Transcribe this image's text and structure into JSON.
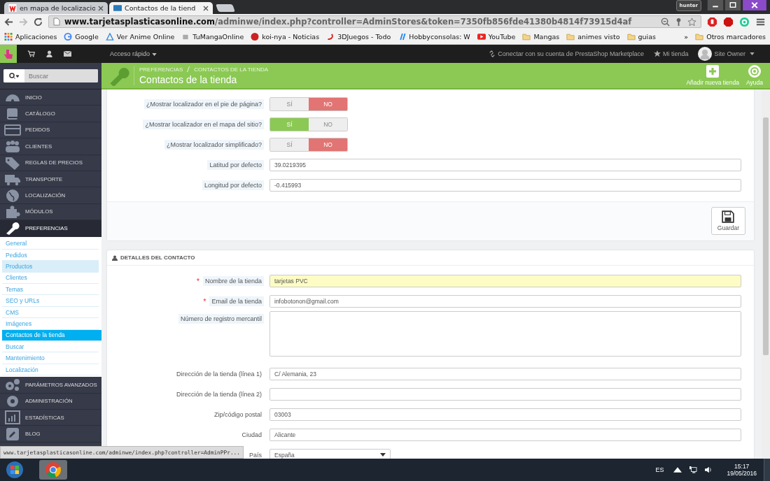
{
  "browser": {
    "tabs": [
      {
        "title": "en mapa de localizacio",
        "selected": false
      },
      {
        "title": "Contactos de la tiend",
        "selected": true
      }
    ],
    "user_badge": "hunter",
    "address": {
      "domain": "www.tarjetasplasticasonline.com",
      "path": "/adminwe/index.php?controller=AdminStores&token=7350fb856fde41380b4814f73915d4af"
    },
    "bookmarks": [
      "Aplicaciones",
      "Google",
      "Ver Anime Online",
      "TuMangaOnline",
      "koi-nya - Noticias",
      "3DJuegos - Todo",
      "Hobbyconsolas: W",
      "YouTube",
      "Mangas",
      "animes visto",
      "guias"
    ],
    "bookmarks_more": "»",
    "other_bookmarks": "Otros marcadores"
  },
  "topnav": {
    "quick_access": "Acceso rápido",
    "marketplace": "Conectar con su cuenta de PrestaShop Marketplace",
    "my_store": "Mi tienda",
    "user": "Site Owner"
  },
  "sidebar": {
    "search_placeholder": "Buscar",
    "items": [
      {
        "label": "INICIO",
        "expanded": false
      },
      {
        "label": "CATÁLOGO",
        "expanded": false
      },
      {
        "label": "PEDIDOS",
        "expanded": false
      },
      {
        "label": "CLIENTES",
        "expanded": false
      },
      {
        "label": "REGLAS DE PRECIOS",
        "expanded": false
      },
      {
        "label": "TRANSPORTE",
        "expanded": false
      },
      {
        "label": "LOCALIZACIÓN",
        "expanded": false
      },
      {
        "label": "MÓDULOS",
        "expanded": false
      },
      {
        "label": "PREFERENCIAS",
        "expanded": true,
        "children": [
          {
            "label": "General",
            "selected": false,
            "hover": false
          },
          {
            "label": "Pedidos",
            "selected": false,
            "hover": false
          },
          {
            "label": "Productos",
            "selected": false,
            "hover": true
          },
          {
            "label": "Clientes",
            "selected": false,
            "hover": false
          },
          {
            "label": "Temas",
            "selected": false,
            "hover": false
          },
          {
            "label": "SEO y URLs",
            "selected": false,
            "hover": false
          },
          {
            "label": "CMS",
            "selected": false,
            "hover": false
          },
          {
            "label": "Imágenes",
            "selected": false,
            "hover": false
          },
          {
            "label": "Contactos de la tienda",
            "selected": true,
            "hover": false
          },
          {
            "label": "Buscar",
            "selected": false,
            "hover": false
          },
          {
            "label": "Mantenimiento",
            "selected": false,
            "hover": false
          },
          {
            "label": "Localización",
            "selected": false,
            "hover": false
          }
        ]
      },
      {
        "label": "PARÁMETROS AVANZADOS",
        "expanded": false
      },
      {
        "label": "ADMINISTRACIÓN",
        "expanded": false
      },
      {
        "label": "ESTADÍSTICAS",
        "expanded": false
      },
      {
        "label": "BLOG",
        "expanded": false
      }
    ]
  },
  "header": {
    "breadcrumb": [
      "PREFERENCIAS",
      "CONTACTOS DE LA TIENDA"
    ],
    "title": "Contactos de la tienda",
    "actions": [
      "Añadir nueva tienda",
      "Ayuda"
    ]
  },
  "options_panel": {
    "toggles": [
      {
        "label": "¿Mostrar localizador en el pie de página?",
        "yes": "SÍ",
        "no": "NO",
        "on": false
      },
      {
        "label": "¿Mostrar localizador en el mapa del sitio?",
        "yes": "SÍ",
        "no": "NO",
        "on": true
      },
      {
        "label": "¿Mostrar localizador simplificado?",
        "yes": "SÍ",
        "no": "NO",
        "on": false
      }
    ],
    "fields": [
      {
        "label": "Latitud por defecto",
        "value": "39.0219395"
      },
      {
        "label": "Longitud por defecto",
        "value": "-0.415993"
      }
    ],
    "save": "Guardar"
  },
  "contact_panel": {
    "title": "DETALLES DEL CONTACTO",
    "fields": [
      {
        "label": "Nombre de la tienda",
        "value": "tarjetas PVC",
        "required_mark": "*",
        "kind": "input",
        "hint": true,
        "highlighted": true
      },
      {
        "label": "Email de la tienda",
        "value": "infobotonon@gmail.com",
        "required_mark": "*",
        "kind": "input",
        "hint": true,
        "highlighted": false
      },
      {
        "label": "Número de registro mercantil",
        "kind": "textarea",
        "hint": true,
        "highlighted": false
      },
      {
        "label": "Dirección de la tienda (línea 1)",
        "value": "C/ Alemania, 23",
        "kind": "input",
        "hint": false,
        "highlighted": false
      },
      {
        "label": "Dirección de la tienda (línea 2)",
        "kind": "input",
        "hint": false,
        "highlighted": false
      },
      {
        "label": "Zip/código postal",
        "value": "03003",
        "kind": "input",
        "hint": false,
        "highlighted": false
      },
      {
        "label": "Ciudad",
        "value": "Alicante",
        "kind": "input",
        "hint": false,
        "highlighted": false
      },
      {
        "label": "País",
        "value": "España",
        "kind": "select",
        "hint": false,
        "highlighted": false
      }
    ]
  },
  "status_url": "www.tarjetasplasticasonline.com/adminwe/index.php?controller=AdminPPr...",
  "taskbar": {
    "language": "ES",
    "time": "15:17",
    "date": "19/05/2016"
  }
}
